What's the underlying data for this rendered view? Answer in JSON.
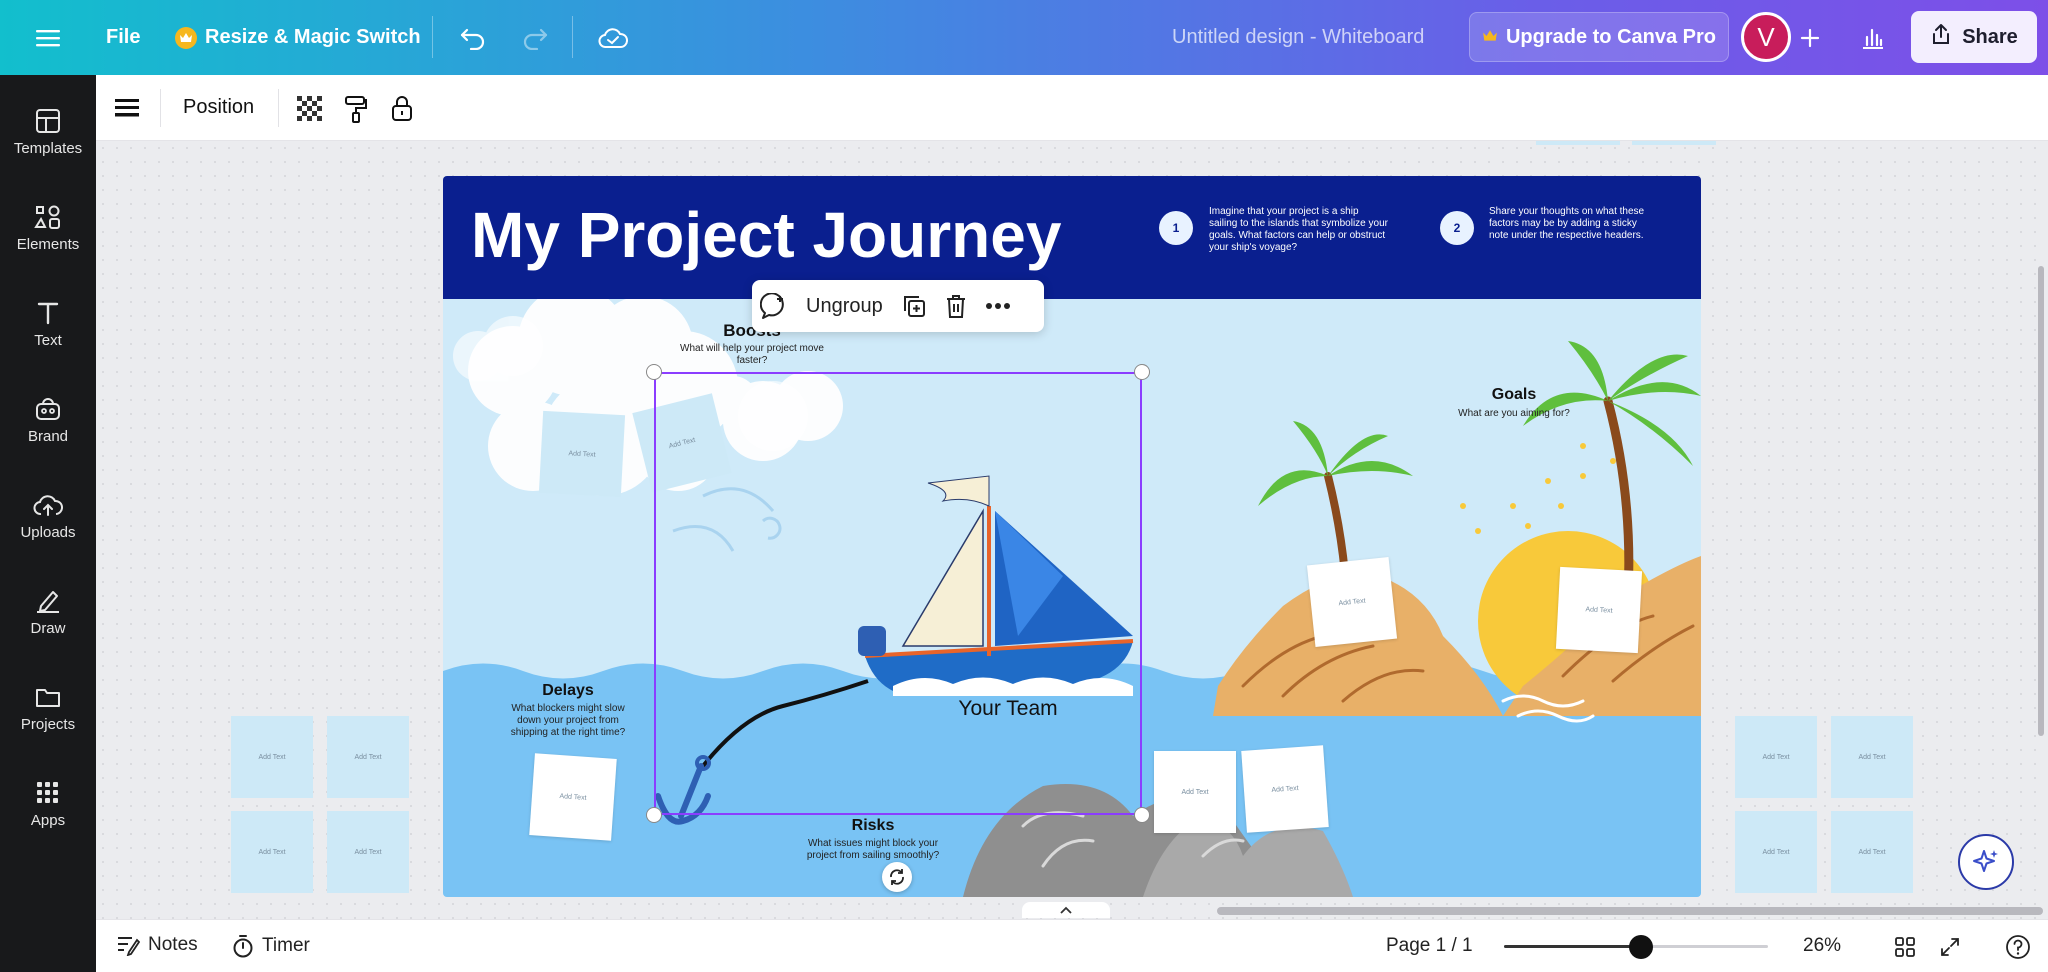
{
  "topbar": {
    "file_label": "File",
    "resize_label": "Resize & Magic Switch",
    "doc_title": "Untitled design - Whiteboard",
    "upgrade_label": "Upgrade to Canva Pro",
    "avatar_letter": "V",
    "share_label": "Share"
  },
  "sidebar": {
    "items": [
      {
        "label": "Templates",
        "icon": "templates-icon"
      },
      {
        "label": "Elements",
        "icon": "elements-icon"
      },
      {
        "label": "Text",
        "icon": "text-icon"
      },
      {
        "label": "Brand",
        "icon": "brand-icon"
      },
      {
        "label": "Uploads",
        "icon": "uploads-icon"
      },
      {
        "label": "Draw",
        "icon": "draw-icon"
      },
      {
        "label": "Projects",
        "icon": "projects-icon"
      },
      {
        "label": "Apps",
        "icon": "apps-icon"
      }
    ]
  },
  "toolbar": {
    "position_label": "Position"
  },
  "floating_toolbar": {
    "ungroup_label": "Ungroup"
  },
  "board": {
    "title": "My Project Journey",
    "step1_num": "1",
    "step1_text": "Imagine that your project is a ship sailing to the islands that symbolize your goals. What factors can help or obstruct your ship's voyage?",
    "step2_num": "2",
    "step2_text": "Share your thoughts on what these factors may be by adding a sticky note under the respective headers.",
    "boosts_title": "Boosts",
    "boosts_sub": "What will help your project move faster?",
    "goals_title": "Goals",
    "goals_sub": "What are you aiming for?",
    "delays_title": "Delays",
    "delays_sub": "What blockers might slow down your  project from shipping at the right time?",
    "risks_title": "Risks",
    "risks_sub": "What issues might block your project from sailing smoothly?",
    "team_label": "Your Team",
    "sticky_text": "Add Text"
  },
  "bottombar": {
    "notes_label": "Notes",
    "timer_label": "Timer",
    "page_label": "Page 1 / 1",
    "zoom_label": "26%",
    "zoom_fraction": 0.52
  },
  "colors": {
    "board_header": "#0a1f8f",
    "sky": "#cfeaf9",
    "sea": "#79c3f4",
    "accent_purple": "#8b3dff"
  }
}
